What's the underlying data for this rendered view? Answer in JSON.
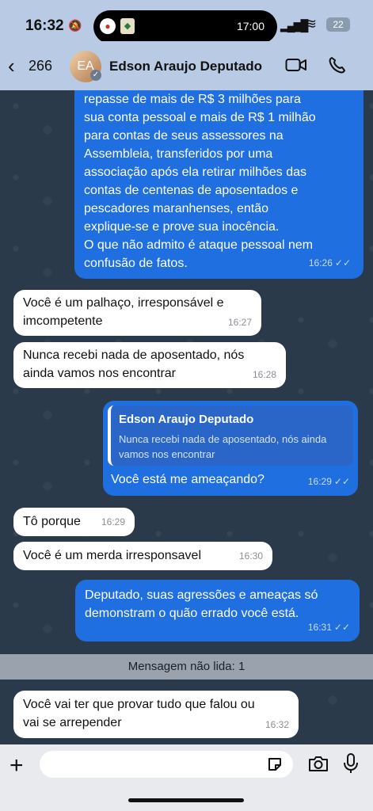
{
  "status_bar": {
    "time": "16:32",
    "island_time": "17:00",
    "battery": "22"
  },
  "header": {
    "back_count": "266",
    "contact_name": "Edson Araujo Deputado"
  },
  "messages": [
    {
      "text": "repasse de mais de R$ 3 milhões para\nsua conta pessoal e mais de R$ 1 milhão\npara contas de seus assessores na\nAssembleia, transferidos por uma\nassociação após ela retirar milhões das\ncontas de centenas de aposentados e\npescadores maranhenses, então\nexplique-se e prove sua inocência.\nO que não admito é ataque pessoal nem\nconfusão de fatos.",
      "time": "16:26"
    },
    {
      "text": "Você é um palhaço, irresponsável e\nimcompetente",
      "time": "16:27"
    },
    {
      "text": "Nunca recebi nada de aposentado, nós\nainda vamos nos encontrar",
      "time": "16:28"
    },
    {
      "quote_name": "Edson Araujo Deputado",
      "quote_text": "Nunca recebi nada de aposentado, nós ainda\nvamos nos encontrar",
      "text": "Você está me ameaçando?",
      "time": "16:29"
    },
    {
      "text": "Tô porque",
      "time": "16:29"
    },
    {
      "text": "Você é um merda irresponsavel",
      "time": "16:30"
    },
    {
      "text": "Deputado, suas agressões e ameaças só\ndemonstram o quão errado você está.",
      "time": "16:31"
    },
    {
      "text": "Você vai ter que provar tudo que falou ou\nvai se arrepender",
      "time": "16:32"
    }
  ],
  "unread_label": "Mensagem não lida: 1",
  "icons": {
    "bell": "bell-off-icon",
    "ticks": "✓✓"
  },
  "colors": {
    "outgoing": "#1f6fe0",
    "incoming": "#ffffff",
    "header": "#b9cbe4"
  }
}
